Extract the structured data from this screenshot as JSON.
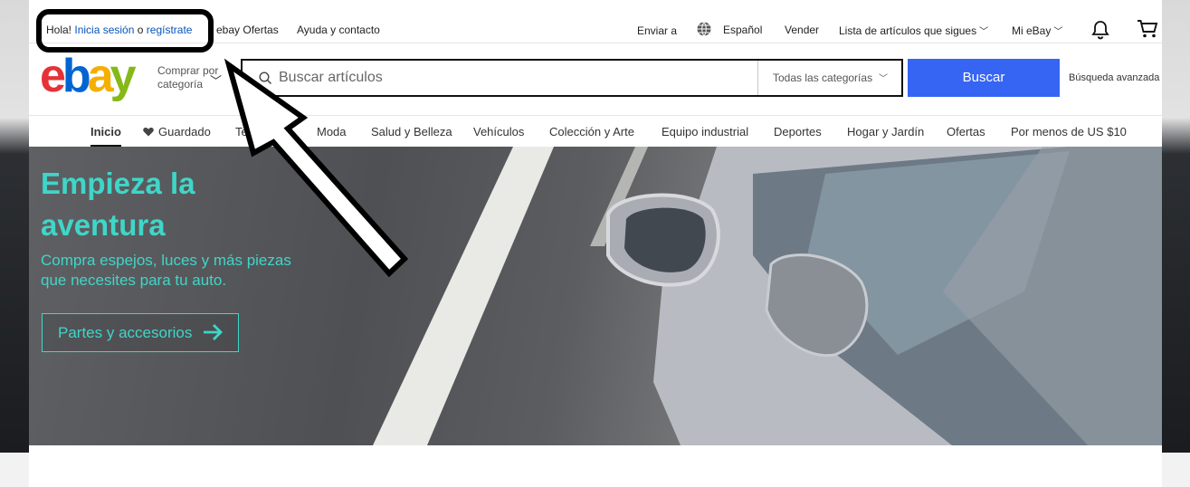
{
  "topbar": {
    "greeting": "Hola!",
    "signin": "Inicia sesión",
    "or": "o",
    "register": "regístrate",
    "deals": "ebay Ofertas",
    "help": "Ayuda y contacto",
    "ship_to": "Enviar a",
    "language": "Español",
    "sell": "Vender",
    "watchlist": "Lista de artículos que sigues",
    "my_ebay": "Mi eBay"
  },
  "header": {
    "logo_letters": [
      "e",
      "b",
      "a",
      "y"
    ],
    "shop_by_category": "Comprar por categoría",
    "search_placeholder": "Buscar artículos",
    "category_select": "Todas las categorías",
    "search_button": "Buscar",
    "advanced_search": "Búsqueda avanzada"
  },
  "nav": {
    "items": [
      "Inicio",
      "Guardado",
      "Tecnología",
      "Moda",
      "Salud y Belleza",
      "Vehículos",
      "Colección y Arte",
      "Equipo industrial",
      "Deportes",
      "Hogar y Jardín",
      "Ofertas",
      "Por menos de US $10"
    ]
  },
  "hero": {
    "title": "Empieza la aventura",
    "subtitle": "Compra espejos, luces y más piezas que necesites para tu auto.",
    "cta": "Partes y accesorios"
  },
  "colors": {
    "accent_teal": "#3fd6c8",
    "search_button": "#3665f3",
    "link_blue": "#0654ba"
  },
  "icons": [
    "globe-icon",
    "bell-icon",
    "cart-icon",
    "search-icon",
    "chevron-down-icon",
    "heart-icon",
    "arrow-right-icon"
  ]
}
